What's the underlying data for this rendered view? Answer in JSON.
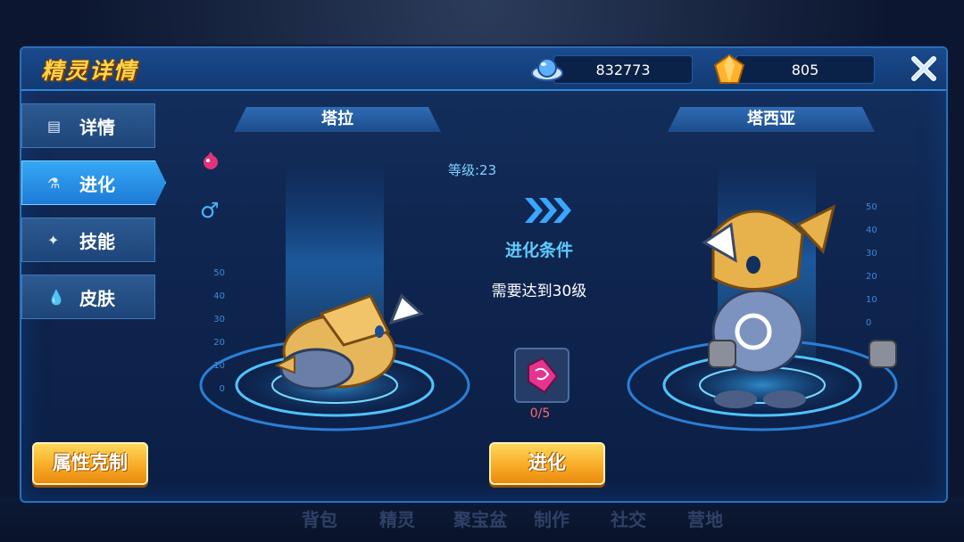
{
  "window": {
    "title": "精灵详情"
  },
  "currency": {
    "coins": "832773",
    "gems": "805"
  },
  "sidebar": {
    "items": [
      {
        "label": "详情",
        "icon": "detail-icon"
      },
      {
        "label": "进化",
        "icon": "flask-icon"
      },
      {
        "label": "技能",
        "icon": "sword-icon"
      },
      {
        "label": "皮肤",
        "icon": "drop-icon"
      }
    ]
  },
  "buttons": {
    "attribute": "属性克制",
    "evolve": "进化"
  },
  "current_pet": {
    "name": "塔拉",
    "level_label": "等级:23",
    "gender": "♂"
  },
  "next_pet": {
    "name": "塔西亚"
  },
  "evolution": {
    "condition_title": "进化条件",
    "condition_text": "需要达到30级",
    "item_count": "0/5"
  },
  "gauge_ticks": [
    "50",
    "40",
    "30",
    "20",
    "10",
    "0"
  ],
  "background_nav": [
    "背包",
    "精灵",
    "聚宝盆",
    "制作",
    "社交",
    "营地"
  ]
}
